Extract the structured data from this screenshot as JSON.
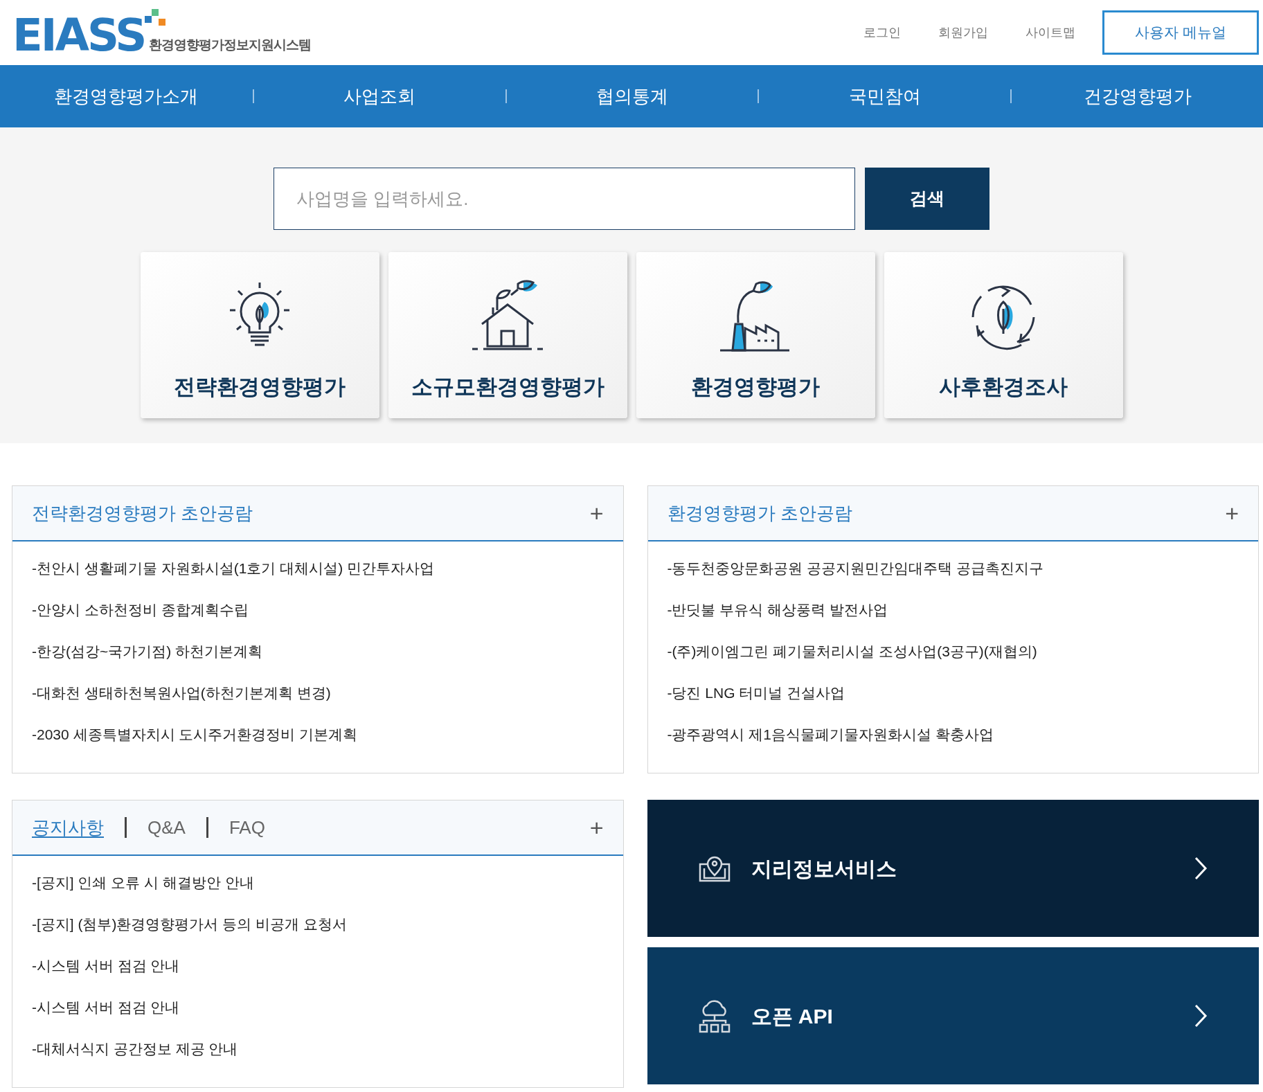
{
  "logo": {
    "mark": "EIASS",
    "subtitle": "환경영향평가정보지원시스템"
  },
  "top_links": [
    "로그인",
    "회원가입",
    "사이트맵"
  ],
  "user_manual_button": "사용자 메뉴얼",
  "nav": [
    "환경영향평가소개",
    "사업조회",
    "협의통계",
    "국민참여",
    "건강영향평가"
  ],
  "search": {
    "placeholder": "사업명을 입력하세요.",
    "button": "검색"
  },
  "cards": [
    {
      "kind": "bulb",
      "label": "전략환경영향평가"
    },
    {
      "kind": "house",
      "label": "소규모환경영향평가"
    },
    {
      "kind": "factory",
      "label": "환경영향평가"
    },
    {
      "kind": "cycle",
      "label": "사후환경조사"
    }
  ],
  "panels": [
    {
      "title": "전략환경영향평가 초안공람",
      "more": "+",
      "items": [
        "-천안시 생활폐기물 자원화시설(1호기 대체시설) 민간투자사업",
        "-안양시 소하천정비 종합계획수립",
        "-한강(섬강~국가기점) 하천기본계획",
        "-대화천 생태하천복원사업(하천기본계획 변경)",
        "-2030 세종특별자치시 도시주거환경정비 기본계획"
      ]
    },
    {
      "title": "환경영향평가 초안공람",
      "more": "+",
      "items": [
        "-동두천중앙문화공원 공공지원민간임대주택 공급촉진지구",
        "-반딧불 부유식 해상풍력 발전사업",
        "-(주)케이엠그린 폐기물처리시설 조성사업(3공구)(재협의)",
        "-당진 LNG 터미널 건설사업",
        "-광주광역시 제1음식물폐기물자원화시설 확충사업"
      ]
    }
  ],
  "board": {
    "tabs": [
      {
        "label": "공지사항",
        "selected": true
      },
      {
        "label": "Q&A",
        "selected": false
      },
      {
        "label": "FAQ",
        "selected": false
      }
    ],
    "more": "+",
    "items": [
      "-[공지] 인쇄 오류 시 해결방안 안내",
      "-[공지] (첨부)환경영향평가서 등의 비공개 요청서",
      "-시스템 서버 점검 안내",
      "-시스템 서버 점검 안내",
      "-대체서식지 공간정보 제공 안내"
    ]
  },
  "services": [
    {
      "kind": "map",
      "label": "지리정보서비스"
    },
    {
      "kind": "api",
      "label": "오픈 API"
    }
  ]
}
